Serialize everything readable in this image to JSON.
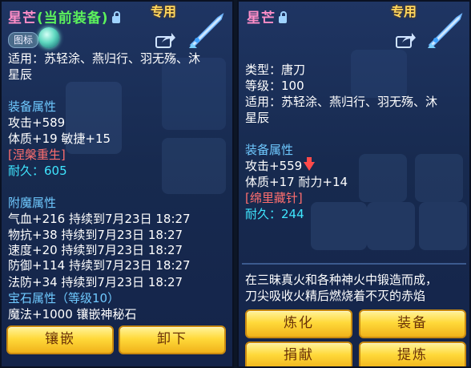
{
  "left": {
    "title_name": "星芒",
    "title_equipped": "(当前装备)",
    "exclusive": "专用",
    "icon_tag": "图标",
    "lines": [
      "适用：苏轻涂、燕归行、羽无殇、沐",
      "星辰"
    ],
    "equip_attr_title": "装备属性",
    "attack": "攻击+589",
    "stats": "体质+19 敏捷+15",
    "refine": "[涅槃重生]",
    "durability": "耐久：605",
    "enchant_title": "附魔属性",
    "enchant": [
      "气血+216 持续到7月23日 18:27",
      "物抗+38 持续到7月23日 18:27",
      "速度+20 持续到7月23日 18:27",
      "防御+114 持续到7月23日 18:27",
      "法防+34 持续到7月23日 18:27"
    ],
    "gem_title": "宝石属性（等级10）",
    "gem_attr": "魔法+1000 镶嵌神秘石",
    "btn_inlay": "镶嵌",
    "btn_unequip": "卸下"
  },
  "right": {
    "title_name": "星芒",
    "exclusive": "专用",
    "type": "类型：唐刀",
    "level": "等级：100",
    "lines": [
      "适用：苏轻涂、燕归行、羽无殇、沐",
      "星辰"
    ],
    "equip_attr_title": "装备属性",
    "attack": "攻击+559",
    "stats": "体质+17 耐力+14",
    "refine": "[绵里藏针]",
    "durability": "耐久：244",
    "desc": [
      "在三昧真火和各种神火中锻造而成，",
      "刀尖吸收火精后燃烧着不灭的赤焰"
    ],
    "btn_refine": "炼化",
    "btn_equip": "装备",
    "btn_donate": "捐献",
    "btn_extract": "提炼"
  },
  "colors": {
    "name_pink": "#ff8ec8",
    "equipped_green": "#5cf15c",
    "section_blue": "#6fc9ff",
    "refine_red": "#ff6e6e",
    "durability_cyan": "#3fe6ff",
    "exclusive_gold": "#ffd75e",
    "button_gold": "#ffd93a"
  },
  "icons": [
    "lock-icon",
    "share-icon",
    "weapon-icon",
    "orb-icon",
    "arrow-down-icon"
  ]
}
